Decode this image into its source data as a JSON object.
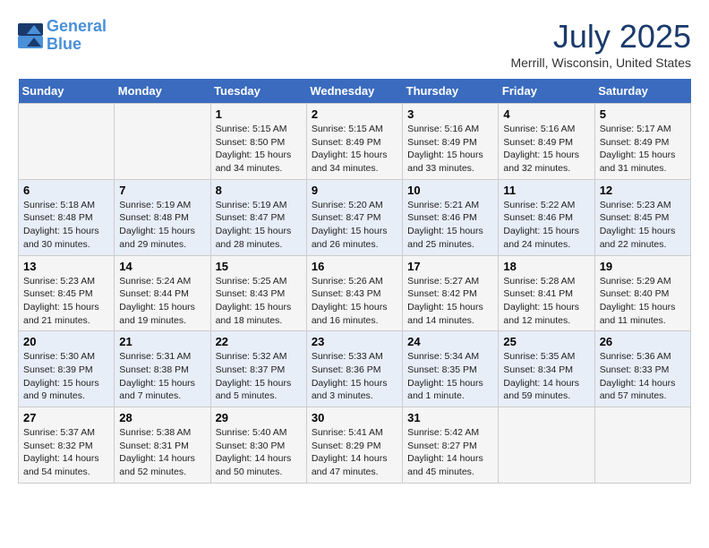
{
  "header": {
    "logo_line1": "General",
    "logo_line2": "Blue",
    "month_year": "July 2025",
    "location": "Merrill, Wisconsin, United States"
  },
  "days_of_week": [
    "Sunday",
    "Monday",
    "Tuesday",
    "Wednesday",
    "Thursday",
    "Friday",
    "Saturday"
  ],
  "weeks": [
    [
      {
        "day": "",
        "info": ""
      },
      {
        "day": "",
        "info": ""
      },
      {
        "day": "1",
        "info": "Sunrise: 5:15 AM\nSunset: 8:50 PM\nDaylight: 15 hours\nand 34 minutes."
      },
      {
        "day": "2",
        "info": "Sunrise: 5:15 AM\nSunset: 8:49 PM\nDaylight: 15 hours\nand 34 minutes."
      },
      {
        "day": "3",
        "info": "Sunrise: 5:16 AM\nSunset: 8:49 PM\nDaylight: 15 hours\nand 33 minutes."
      },
      {
        "day": "4",
        "info": "Sunrise: 5:16 AM\nSunset: 8:49 PM\nDaylight: 15 hours\nand 32 minutes."
      },
      {
        "day": "5",
        "info": "Sunrise: 5:17 AM\nSunset: 8:49 PM\nDaylight: 15 hours\nand 31 minutes."
      }
    ],
    [
      {
        "day": "6",
        "info": "Sunrise: 5:18 AM\nSunset: 8:48 PM\nDaylight: 15 hours\nand 30 minutes."
      },
      {
        "day": "7",
        "info": "Sunrise: 5:19 AM\nSunset: 8:48 PM\nDaylight: 15 hours\nand 29 minutes."
      },
      {
        "day": "8",
        "info": "Sunrise: 5:19 AM\nSunset: 8:47 PM\nDaylight: 15 hours\nand 28 minutes."
      },
      {
        "day": "9",
        "info": "Sunrise: 5:20 AM\nSunset: 8:47 PM\nDaylight: 15 hours\nand 26 minutes."
      },
      {
        "day": "10",
        "info": "Sunrise: 5:21 AM\nSunset: 8:46 PM\nDaylight: 15 hours\nand 25 minutes."
      },
      {
        "day": "11",
        "info": "Sunrise: 5:22 AM\nSunset: 8:46 PM\nDaylight: 15 hours\nand 24 minutes."
      },
      {
        "day": "12",
        "info": "Sunrise: 5:23 AM\nSunset: 8:45 PM\nDaylight: 15 hours\nand 22 minutes."
      }
    ],
    [
      {
        "day": "13",
        "info": "Sunrise: 5:23 AM\nSunset: 8:45 PM\nDaylight: 15 hours\nand 21 minutes."
      },
      {
        "day": "14",
        "info": "Sunrise: 5:24 AM\nSunset: 8:44 PM\nDaylight: 15 hours\nand 19 minutes."
      },
      {
        "day": "15",
        "info": "Sunrise: 5:25 AM\nSunset: 8:43 PM\nDaylight: 15 hours\nand 18 minutes."
      },
      {
        "day": "16",
        "info": "Sunrise: 5:26 AM\nSunset: 8:43 PM\nDaylight: 15 hours\nand 16 minutes."
      },
      {
        "day": "17",
        "info": "Sunrise: 5:27 AM\nSunset: 8:42 PM\nDaylight: 15 hours\nand 14 minutes."
      },
      {
        "day": "18",
        "info": "Sunrise: 5:28 AM\nSunset: 8:41 PM\nDaylight: 15 hours\nand 12 minutes."
      },
      {
        "day": "19",
        "info": "Sunrise: 5:29 AM\nSunset: 8:40 PM\nDaylight: 15 hours\nand 11 minutes."
      }
    ],
    [
      {
        "day": "20",
        "info": "Sunrise: 5:30 AM\nSunset: 8:39 PM\nDaylight: 15 hours\nand 9 minutes."
      },
      {
        "day": "21",
        "info": "Sunrise: 5:31 AM\nSunset: 8:38 PM\nDaylight: 15 hours\nand 7 minutes."
      },
      {
        "day": "22",
        "info": "Sunrise: 5:32 AM\nSunset: 8:37 PM\nDaylight: 15 hours\nand 5 minutes."
      },
      {
        "day": "23",
        "info": "Sunrise: 5:33 AM\nSunset: 8:36 PM\nDaylight: 15 hours\nand 3 minutes."
      },
      {
        "day": "24",
        "info": "Sunrise: 5:34 AM\nSunset: 8:35 PM\nDaylight: 15 hours\nand 1 minute."
      },
      {
        "day": "25",
        "info": "Sunrise: 5:35 AM\nSunset: 8:34 PM\nDaylight: 14 hours\nand 59 minutes."
      },
      {
        "day": "26",
        "info": "Sunrise: 5:36 AM\nSunset: 8:33 PM\nDaylight: 14 hours\nand 57 minutes."
      }
    ],
    [
      {
        "day": "27",
        "info": "Sunrise: 5:37 AM\nSunset: 8:32 PM\nDaylight: 14 hours\nand 54 minutes."
      },
      {
        "day": "28",
        "info": "Sunrise: 5:38 AM\nSunset: 8:31 PM\nDaylight: 14 hours\nand 52 minutes."
      },
      {
        "day": "29",
        "info": "Sunrise: 5:40 AM\nSunset: 8:30 PM\nDaylight: 14 hours\nand 50 minutes."
      },
      {
        "day": "30",
        "info": "Sunrise: 5:41 AM\nSunset: 8:29 PM\nDaylight: 14 hours\nand 47 minutes."
      },
      {
        "day": "31",
        "info": "Sunrise: 5:42 AM\nSunset: 8:27 PM\nDaylight: 14 hours\nand 45 minutes."
      },
      {
        "day": "",
        "info": ""
      },
      {
        "day": "",
        "info": ""
      }
    ]
  ]
}
